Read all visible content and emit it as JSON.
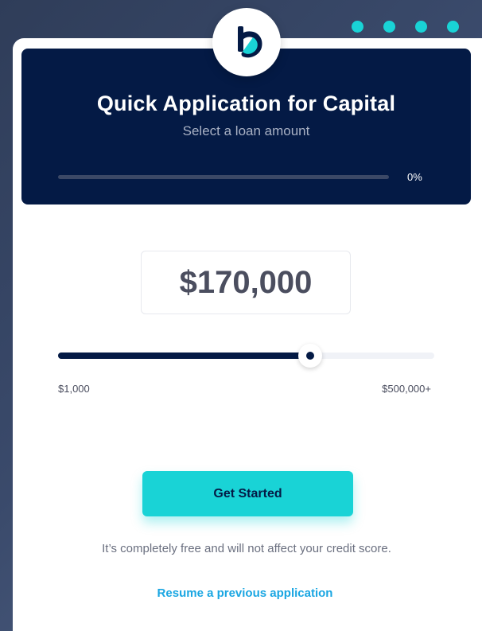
{
  "header": {
    "title": "Quick Application for Capital",
    "subtitle": "Select a loan amount",
    "progress_percent": 0,
    "progress_label": "0%"
  },
  "loan": {
    "amount_display": "$170,000",
    "slider_value_fraction": 0.67,
    "min_label": "$1,000",
    "max_label": "$500,000+"
  },
  "cta": {
    "label": "Get Started"
  },
  "disclaimer": "It’s completely free and will not affect your credit score.",
  "resume_link": "Resume a previous application",
  "icons": {
    "logo": "brand-b-logo-icon"
  },
  "colors": {
    "navy": "#041a45",
    "teal": "#19d3d6",
    "link": "#1aa6e2"
  }
}
